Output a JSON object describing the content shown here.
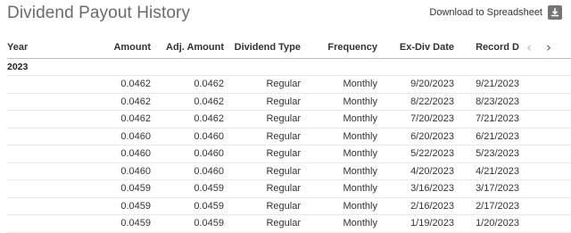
{
  "header": {
    "title": "Dividend Payout History",
    "download_label": "Download to Spreadsheet",
    "download_icon": "download-icon"
  },
  "table": {
    "columns": [
      "Year",
      "Amount",
      "Adj. Amount",
      "Dividend Type",
      "Frequency",
      "Ex-Div Date",
      "Record D"
    ],
    "nav": {
      "prev_icon": "chevron-left-icon",
      "next_icon": "chevron-right-icon",
      "prev": "‹",
      "next": "›"
    },
    "year_group": "2023",
    "rows": [
      [
        "",
        "0.0462",
        "0.0462",
        "Regular",
        "Monthly",
        "9/20/2023",
        "9/21/2023"
      ],
      [
        "",
        "0.0462",
        "0.0462",
        "Regular",
        "Monthly",
        "8/22/2023",
        "8/23/2023"
      ],
      [
        "",
        "0.0462",
        "0.0462",
        "Regular",
        "Monthly",
        "7/20/2023",
        "7/21/2023"
      ],
      [
        "",
        "0.0460",
        "0.0460",
        "Regular",
        "Monthly",
        "6/20/2023",
        "6/21/2023"
      ],
      [
        "",
        "0.0460",
        "0.0460",
        "Regular",
        "Monthly",
        "5/22/2023",
        "5/23/2023"
      ],
      [
        "",
        "0.0460",
        "0.0460",
        "Regular",
        "Monthly",
        "4/20/2023",
        "4/21/2023"
      ],
      [
        "",
        "0.0459",
        "0.0459",
        "Regular",
        "Monthly",
        "3/16/2023",
        "3/17/2023"
      ],
      [
        "",
        "0.0459",
        "0.0459",
        "Regular",
        "Monthly",
        "2/16/2023",
        "2/17/2023"
      ],
      [
        "",
        "0.0459",
        "0.0459",
        "Regular",
        "Monthly",
        "1/19/2023",
        "1/20/2023"
      ]
    ]
  }
}
